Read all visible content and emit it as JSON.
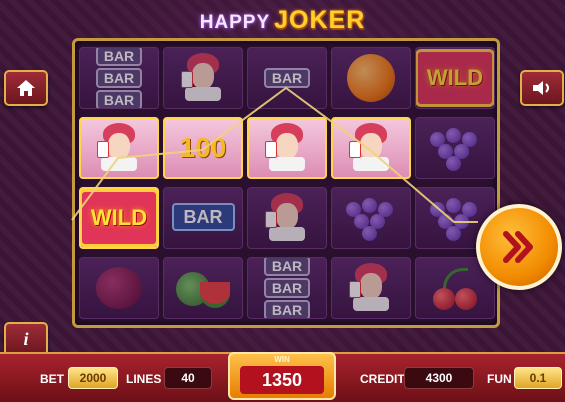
{
  "title": {
    "part1": "HAPPY",
    "part2": "JOKER"
  },
  "reels": {
    "symbols": [
      [
        "bar-triple",
        "joker-card",
        "bar-single",
        "orange",
        "wild"
      ],
      [
        "joker-card",
        "hundred",
        "joker-card",
        "joker-card",
        "grapes"
      ],
      [
        "wild",
        "bar-blue",
        "joker-card",
        "grapes",
        "grapes"
      ],
      [
        "plum",
        "watermelon",
        "bar-triple",
        "joker-card",
        "cherries"
      ]
    ],
    "winning": [
      [
        1,
        0
      ],
      [
        1,
        1
      ],
      [
        1,
        2
      ],
      [
        1,
        3
      ],
      [
        2,
        0
      ]
    ],
    "bar_text": "BAR",
    "wild_text": "WILD",
    "hundred_text": "100"
  },
  "buttons": {
    "home": "home-icon",
    "sound": "speaker-icon",
    "info_text": "i",
    "spin": "double-chevron-right-icon"
  },
  "bottom": {
    "bet_label": "BET",
    "bet_value": "2000",
    "lines_label": "LINES",
    "lines_value": "40",
    "win_label": "WIN",
    "win_value": "1350",
    "credit_label": "CREDIT",
    "credit_value": "4300",
    "fun_label": "FUN",
    "fun_value": "0.1"
  },
  "colors": {
    "background": "#3d1638",
    "accent_gold": "#ffcf2e",
    "button_red": "#9e2c36",
    "spin_orange": "#f28c00",
    "payline": "#f0d27a"
  }
}
